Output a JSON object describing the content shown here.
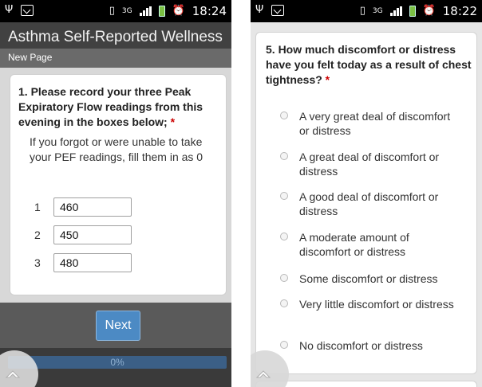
{
  "left_screen": {
    "status_bar": {
      "left_icons": [
        "usb-icon",
        "debug-icon"
      ],
      "right_icons": [
        "vibrate-icon",
        "network-type-icon",
        "signal-icon",
        "battery-icon",
        "alarm-icon"
      ],
      "network_type": "3G",
      "time": "18:24"
    },
    "app_title": "Asthma Self-Reported Wellness",
    "page_name": "New Page",
    "question": {
      "text": "1. Please record your three Peak Expiratory Flow readings from this evening in the boxes below;",
      "required_mark": "*"
    },
    "hint": "If you forgot or were unable to take your PEF readings, fill them in as 0",
    "readings": [
      {
        "label": "1",
        "value": "460"
      },
      {
        "label": "2",
        "value": "450"
      },
      {
        "label": "3",
        "value": "480"
      }
    ],
    "next_label": "Next",
    "progress_label": "0%",
    "progress_value": 0
  },
  "right_screen": {
    "status_bar": {
      "left_icons": [
        "usb-icon",
        "debug-icon"
      ],
      "right_icons": [
        "vibrate-icon",
        "network-type-icon",
        "signal-icon",
        "battery-icon",
        "alarm-icon"
      ],
      "network_type": "3G",
      "time": "18:22"
    },
    "question": {
      "text": "5. How much discomfort or distress have you felt today as a result of chest tightness?",
      "required_mark": "*"
    },
    "options": [
      "A very great deal of discomfort or distress",
      "A great deal of discomfort or distress",
      "A good deal of discomfort or distress",
      "A moderate amount of discomfort or distress",
      "Some discomfort or distress",
      "Very little discomfort or distress",
      "No discomfort or distress"
    ]
  },
  "colors": {
    "accent": "#4c8ac4",
    "header": "#414141",
    "required": "#cc0000"
  }
}
